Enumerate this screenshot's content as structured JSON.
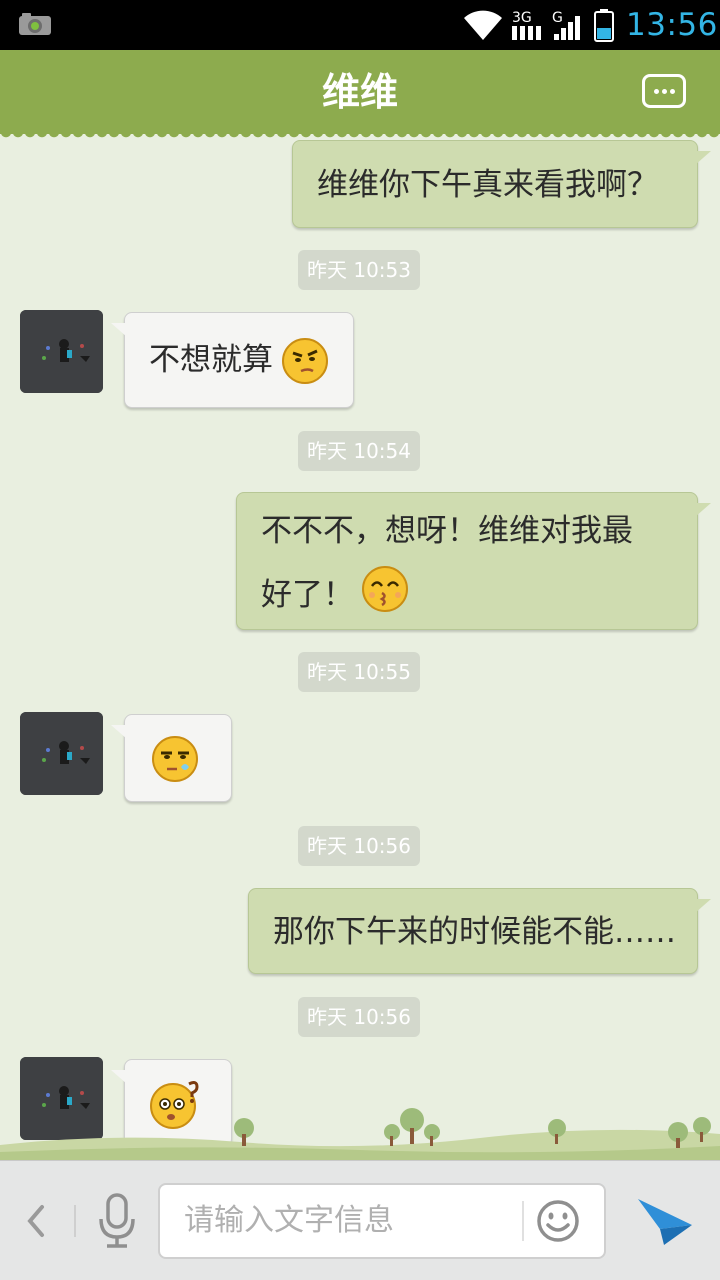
{
  "status_bar": {
    "time": "13:56",
    "network_3g": "3G",
    "network_g": "G",
    "icons": [
      "camera-icon",
      "wifi-icon",
      "signal-3g-icon",
      "signal-g-icon",
      "battery-icon"
    ]
  },
  "header": {
    "title": "维维",
    "menu_icon": "more-dots-icon"
  },
  "messages": [
    {
      "type": "sent",
      "text": "维维你下午真来看我啊？"
    },
    {
      "type": "timestamp",
      "text": "昨天 10:53"
    },
    {
      "type": "received",
      "text": "不想就算",
      "emoji": "smirk-emoji-icon"
    },
    {
      "type": "timestamp",
      "text": "昨天 10:54"
    },
    {
      "type": "sent",
      "line1": "不不不，想呀！维维对我最",
      "line2": "好了！",
      "emoji": "kiss-emoji-icon"
    },
    {
      "type": "timestamp",
      "text": "昨天 10:55"
    },
    {
      "type": "received",
      "emoji": "sweat-emoji-icon"
    },
    {
      "type": "timestamp",
      "text": "昨天 10:56"
    },
    {
      "type": "sent",
      "text": "那你下午来的时候能不能……"
    },
    {
      "type": "timestamp",
      "text": "昨天 10:56"
    },
    {
      "type": "received",
      "emoji": "confused-emoji-icon"
    }
  ],
  "input_bar": {
    "placeholder": "请输入文字信息",
    "icons": [
      "back-chevron-icon",
      "microphone-icon",
      "emoji-smile-icon",
      "send-icon"
    ]
  },
  "colors": {
    "header": "#8dab4e",
    "chat_background": "#e9efe0",
    "sent_bubble": "#cfdcb0",
    "received_bubble": "#f5f5f3",
    "clock": "#33b5e5",
    "send_icon": "#2f8fd8"
  }
}
